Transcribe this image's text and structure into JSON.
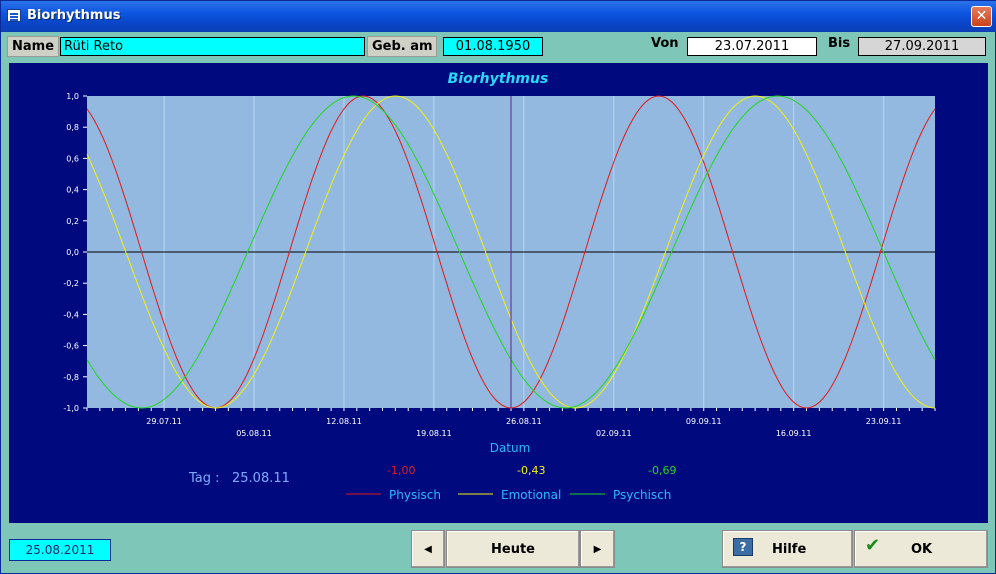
{
  "window": {
    "title": "Biorhythmus",
    "close_glyph": "✕"
  },
  "form": {
    "name_label": "Name",
    "name_value": "Rüti Reto",
    "birth_label": "Geb. am",
    "birth_value": "01.08.1950",
    "from_label": "Von",
    "from_value": "23.07.2011",
    "to_label": "Bis",
    "to_value": "27.09.2011"
  },
  "chart_data": {
    "type": "line",
    "title": "Biorhythmus",
    "xlabel": "Datum",
    "ylabel": "",
    "x_range": [
      "23.07.11",
      "27.09.11"
    ],
    "ylim": [
      -1.0,
      1.0
    ],
    "y_ticks": [
      "1,0",
      "0,8",
      "0,6",
      "0,4",
      "0,2",
      "0,0",
      "-0,2",
      "-0,4",
      "-0,6",
      "-0,8",
      "-1,0"
    ],
    "x_tick_labels": [
      "29.07.11",
      "05.08.11",
      "12.08.11",
      "19.08.11",
      "26.08.11",
      "02.09.11",
      "09.09.11",
      "16.09.11",
      "23.09.11"
    ],
    "cursor_date": "25.08.11",
    "series": [
      {
        "name": "Physisch",
        "color": "#e01a1a",
        "period_days": 23,
        "value_at_cursor": -1.0
      },
      {
        "name": "Emotional",
        "color": "#f2f20a",
        "period_days": 28,
        "value_at_cursor": -0.43
      },
      {
        "name": "Psychisch",
        "color": "#1ed61e",
        "period_days": 33,
        "value_at_cursor": -0.69
      }
    ],
    "grid": true,
    "legend_position": "bottom"
  },
  "readout": {
    "tag_label": "Tag :",
    "tag_value": "25.08.11",
    "phys_value": "-1,00",
    "emo_value": "-0,43",
    "psy_value": "-0,69"
  },
  "legend": {
    "phys": "Physisch",
    "emo": "Emotional",
    "psy": "Psychisch"
  },
  "footer": {
    "date": "25.08.2011",
    "prev_glyph": "◀",
    "today_label": "Heute",
    "next_glyph": "▶",
    "help_icon_glyph": "?",
    "help_label": "Hilfe",
    "ok_icon_glyph": "✔",
    "ok_label": "OK"
  },
  "colors": {
    "chart_bg": "#000a7e",
    "plot_bg": "#93b9e0",
    "title_color": "#28d8ff"
  }
}
